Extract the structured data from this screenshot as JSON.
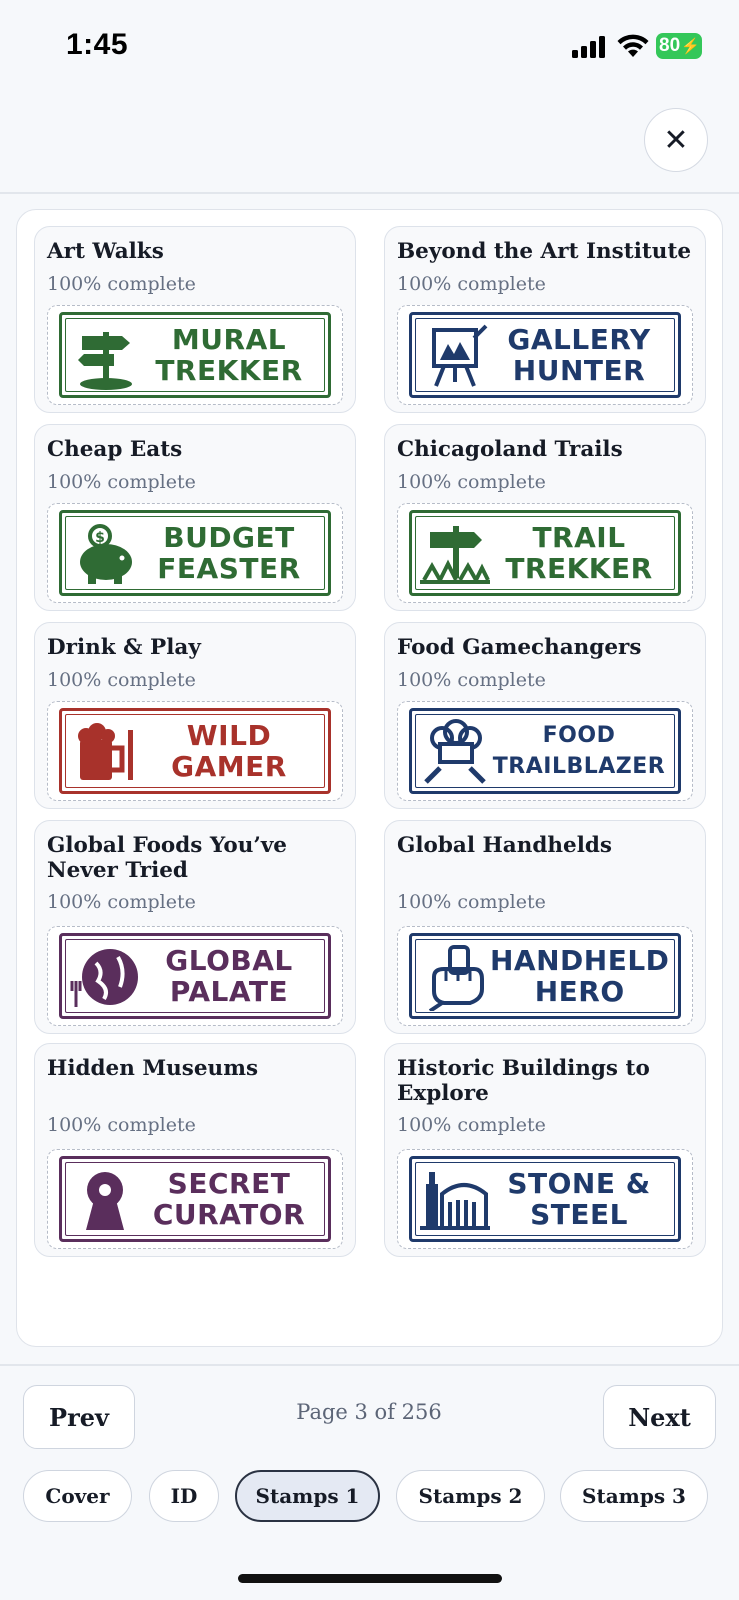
{
  "status_bar": {
    "time": "1:45",
    "battery": "80"
  },
  "close_label": "✕",
  "stamps": [
    {
      "title": "Art Walks",
      "progress": "100% complete",
      "line1": "MURAL",
      "line2": "TREKKER",
      "icon": "signpost-icon",
      "color": "#2f6b34"
    },
    {
      "title": "Beyond the Art Institute",
      "progress": "100% complete",
      "line1": "GALLERY",
      "line2": "HUNTER",
      "icon": "easel-icon",
      "color": "#1f3a6b"
    },
    {
      "title": "Cheap Eats",
      "progress": "100% complete",
      "line1": "BUDGET",
      "line2": "FEASTER",
      "icon": "piggy-bank-icon",
      "color": "#2f6b34"
    },
    {
      "title": "Chicagoland Trails",
      "progress": "100% complete",
      "line1": "TRAIL",
      "line2": "TREKKER",
      "icon": "trail-sign-icon",
      "color": "#2f6b34"
    },
    {
      "title": "Drink & Play",
      "progress": "100% complete",
      "line1": "WILD",
      "line2": "GAMER",
      "icon": "beer-mug-icon",
      "color": "#a8322b"
    },
    {
      "title": "Food Gamechangers",
      "progress": "100% complete",
      "line1": "FOOD",
      "line2": "TRAILBLAZER",
      "icon": "chef-hat-icon",
      "color": "#1f3a6b"
    },
    {
      "title": "Global Foods You’ve Never Tried",
      "progress": "100% complete",
      "line1": "GLOBAL",
      "line2": "PALATE",
      "icon": "globe-icon",
      "color": "#5a2e5c"
    },
    {
      "title": "Global Handhelds",
      "progress": "100% complete",
      "line1": "HANDHELD",
      "line2": "HERO",
      "icon": "fist-icon",
      "color": "#1f3a6b"
    },
    {
      "title": "Hidden Museums",
      "progress": "100% complete",
      "line1": "SECRET",
      "line2": "CURATOR",
      "icon": "keyhole-icon",
      "color": "#5a2e5c"
    },
    {
      "title": "Historic Buildings to Explore",
      "progress": "100% complete",
      "line1": "STONE &",
      "line2": "STEEL",
      "icon": "skyline-icon",
      "color": "#1f3a6b"
    }
  ],
  "pager": {
    "prev": "Prev",
    "next": "Next",
    "indicator": "Page 3 of 256"
  },
  "tabs": [
    "Cover",
    "ID",
    "Stamps 1",
    "Stamps 2",
    "Stamps 3"
  ],
  "active_tab": "Stamps 1"
}
